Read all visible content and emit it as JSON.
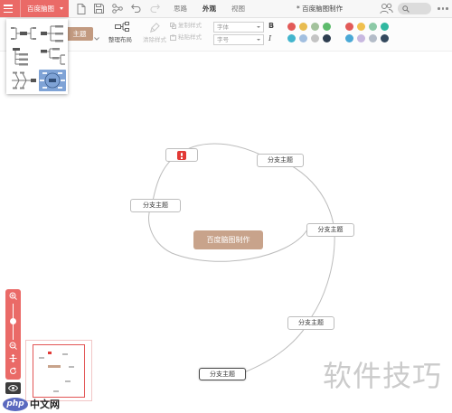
{
  "colors": {
    "accent": "#ea6a67",
    "root_node": "#c8a38b",
    "theme_button": "#c29a80"
  },
  "app": {
    "brand": "百度脑图",
    "document_title": "* 百度脑图制作"
  },
  "header_icons": [
    "menu-icon",
    "new-file-icon",
    "save-icon",
    "share-icon",
    "undo-icon",
    "redo-icon",
    "user-icon",
    "search-icon",
    "more-icon"
  ],
  "tabs": [
    {
      "label": "思路",
      "active": false
    },
    {
      "label": "外观",
      "active": true
    },
    {
      "label": "视图",
      "active": false
    }
  ],
  "toolbar": {
    "theme_label": "主题",
    "reset_layout_label": "整理布局",
    "clear_style_label": "清除样式",
    "copy_style_label": "复制样式",
    "paste_style_label": "粘贴样式",
    "font_family_placeholder": "字体",
    "font_size_placeholder": "字号",
    "bold_label": "B",
    "italic_label": "I",
    "font_colors": [
      "#e25a58",
      "#e8bc50",
      "#a3c29c",
      "#5dbb6c",
      "#42b5cd",
      "#a2bfe0",
      "#c4c4c4",
      "#2e3e50"
    ],
    "background_colors": [
      "#e25a58",
      "#f0c04e",
      "#8cc9a6",
      "#30b8a0",
      "#4aa8d6",
      "#c8b8e0",
      "#b4bcc8",
      "#34495e"
    ]
  },
  "template_menu": {
    "open": true,
    "selected_index": 5,
    "option_icons": [
      "mind-map-template-icon",
      "right-structure-template-icon",
      "filetree-template-icon",
      "logic-template-icon",
      "fishbone-template-icon",
      "tianpan-template-icon"
    ]
  },
  "mindmap": {
    "root": {
      "text": "百度脑图制作"
    },
    "branches": [
      {
        "icon": "red-badge-icon"
      },
      {
        "text": "分支主题"
      },
      {
        "text": "分支主题"
      },
      {
        "text": "分支主题"
      },
      {
        "text": "分支主题"
      },
      {
        "text": "分支主题"
      }
    ],
    "selected_branch_index": 5
  },
  "watermarks": {
    "php_logo_mark": "php",
    "php_logo_text": "中文网",
    "tips_text": "软件技巧"
  }
}
